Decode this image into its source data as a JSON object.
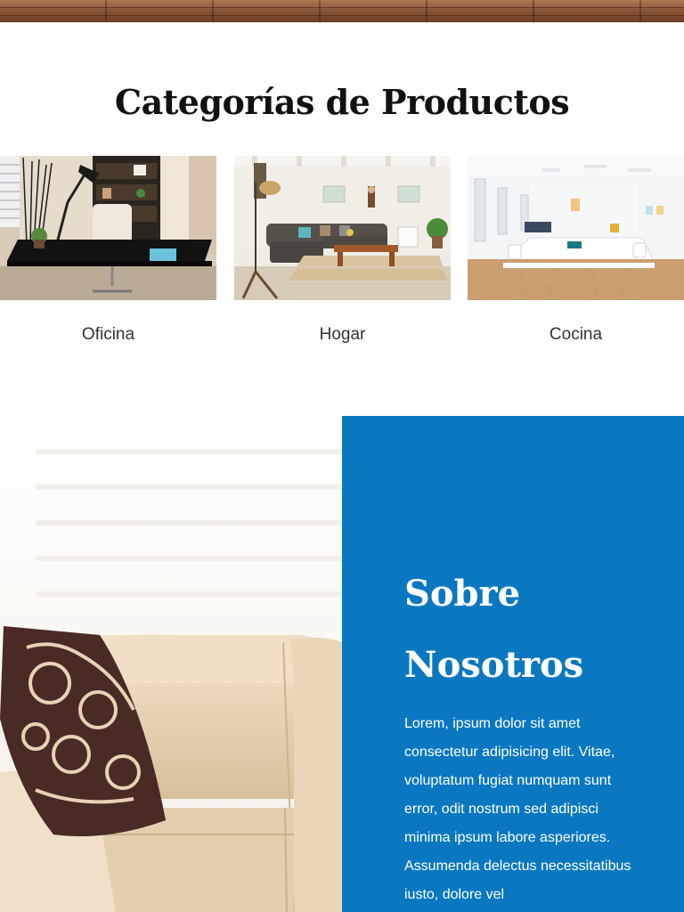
{
  "categories": {
    "title": "Categorías de Productos",
    "items": [
      {
        "label": "Oficina",
        "image": "office-photo"
      },
      {
        "label": "Hogar",
        "image": "living-room-photo"
      },
      {
        "label": "Cocina",
        "image": "dining-room-photo"
      }
    ]
  },
  "about": {
    "title_line1": "Sobre",
    "title_line2": "Nosotros",
    "text": "Lorem, ipsum dolor sit amet consectetur adipisicing elit. Vitae, voluptatum fugiat numquam sunt error, odit nostrum sed adipisci minima ipsum labore asperiores. Assumenda delectus necessitatibus iusto, dolore vel",
    "panel_color": "#0a78c0"
  }
}
